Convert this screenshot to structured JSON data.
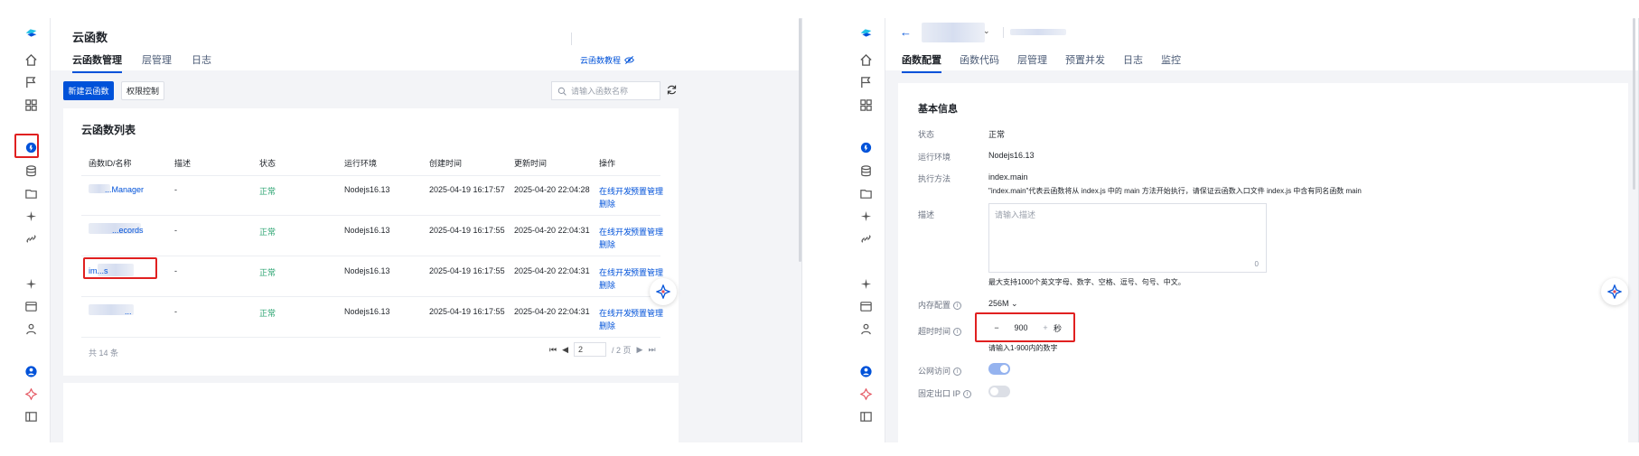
{
  "left": {
    "title": "云函数",
    "tabs": [
      "云函数管理",
      "层管理",
      "日志"
    ],
    "tutorial_link": "云函数教程",
    "buttons": {
      "new": "新建云函数",
      "permission": "权限控制"
    },
    "search": {
      "placeholder": "请输入函数名称"
    },
    "list_title": "云函数列表",
    "columns": [
      "函数ID/名称",
      "描述",
      "状态",
      "运行环境",
      "创建时间",
      "更新时间",
      "操作"
    ],
    "rows": [
      {
        "name": "...Manager",
        "desc": "-",
        "status": "正常",
        "runtime": "Nodejs16.13",
        "created": "2025-04-19 16:17:57",
        "updated": "2025-04-20 22:04:28",
        "op1": "在线开发",
        "op2": "预置管理",
        "op3": "删除"
      },
      {
        "name": "...ecords",
        "desc": "-",
        "status": "正常",
        "runtime": "Nodejs16.13",
        "created": "2025-04-19 16:17:55",
        "updated": "2025-04-20 22:04:31",
        "op1": "在线开发",
        "op2": "预置管理",
        "op3": "删除"
      },
      {
        "name": "im...s",
        "desc": "-",
        "status": "正常",
        "runtime": "Nodejs16.13",
        "created": "2025-04-19 16:17:55",
        "updated": "2025-04-20 22:04:31",
        "op1": "在线开发",
        "op2": "预置管理",
        "op3": "删除"
      },
      {
        "name": "...",
        "desc": "-",
        "status": "正常",
        "runtime": "Nodejs16.13",
        "created": "2025-04-19 16:17:55",
        "updated": "2025-04-20 22:04:31",
        "op1": "在线开发",
        "op2": "预置管理",
        "op3": "删除"
      }
    ],
    "total": "共 14 条",
    "pagination": {
      "page": "2",
      "pages": "/ 2 页"
    }
  },
  "right": {
    "tabs": [
      "函数配置",
      "函数代码",
      "层管理",
      "预置并发",
      "日志",
      "监控"
    ],
    "section_title": "基本信息",
    "fields": {
      "status_label": "状态",
      "status_value": "正常",
      "runtime_label": "运行环境",
      "runtime_value": "Nodejs16.13",
      "handler_label": "执行方法",
      "handler_value": "index.main",
      "handler_hint": "\"index.main\"代表云函数将从 index.js 中的 main 方法开始执行，请保证云函数入口文件 index.js 中含有同名函数 main",
      "desc_label": "描述",
      "desc_placeholder": "请输入描述",
      "desc_count": "0",
      "desc_hint": "最大支持1000个英文字母、数字、空格、逗号、句号、中文。",
      "memory_label": "内存配置",
      "memory_value": "256M",
      "timeout_label": "超时时间",
      "timeout_value": "900",
      "timeout_unit": "秒",
      "timeout_hint": "请输入1-900内的数字",
      "public_label": "公网访问",
      "fixed_ip_label": "固定出口 IP"
    }
  },
  "colors": {
    "primary": "#0052d9",
    "success": "#2ba471",
    "highlight": "#e02020"
  }
}
